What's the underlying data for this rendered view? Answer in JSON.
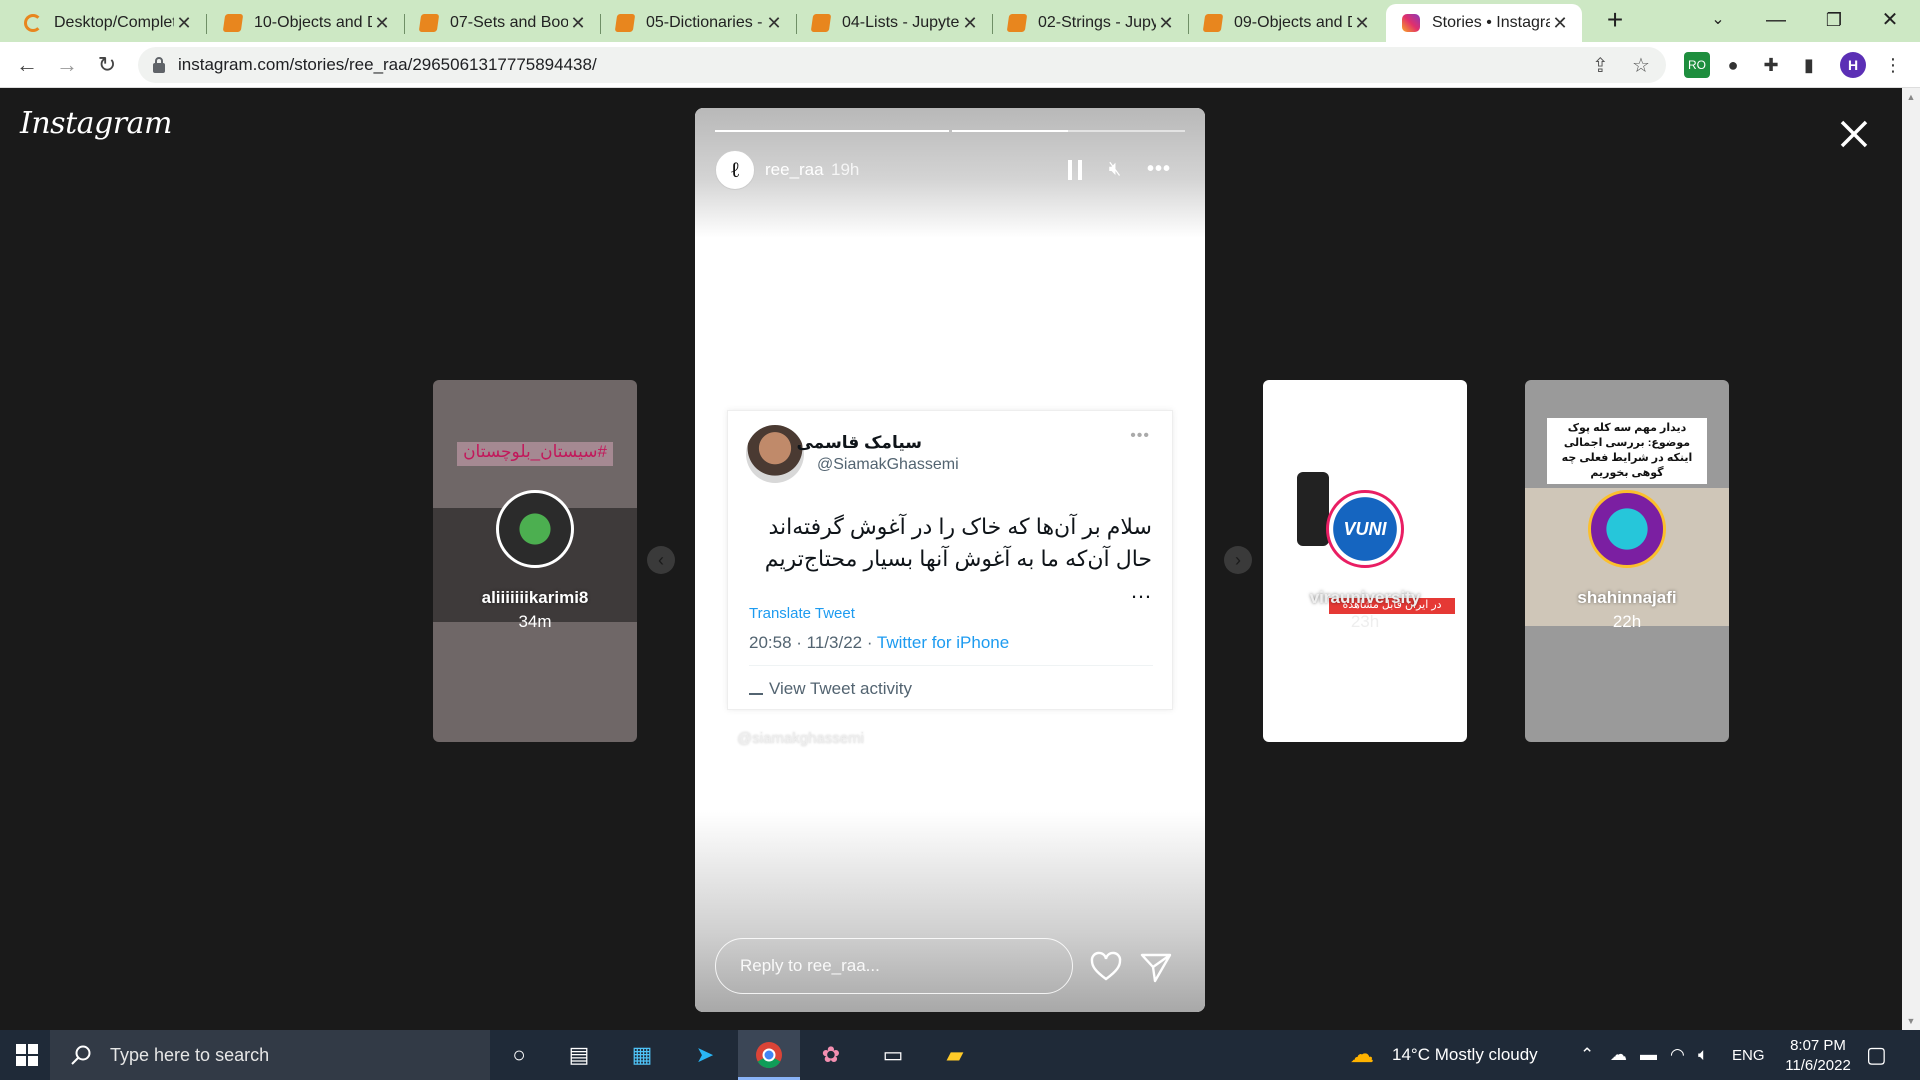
{
  "browser": {
    "tabs": [
      {
        "title": "Desktop/Complet",
        "icon": "loading-spinner-icon"
      },
      {
        "title": "10-Objects and D",
        "icon": "jupyter-notebook-icon"
      },
      {
        "title": "07-Sets and Bool",
        "icon": "jupyter-notebook-icon"
      },
      {
        "title": "05-Dictionaries -",
        "icon": "jupyter-notebook-icon"
      },
      {
        "title": "04-Lists - Jupyter",
        "icon": "jupyter-notebook-icon"
      },
      {
        "title": "02-Strings - Jupy",
        "icon": "jupyter-notebook-icon"
      },
      {
        "title": "09-Objects and D",
        "icon": "jupyter-notebook-icon"
      },
      {
        "title": "Stories • Instagra",
        "icon": "instagram-icon",
        "active": true
      }
    ],
    "url": "instagram.com/stories/ree_raa/2965061317775894438/",
    "profile_initial": "H",
    "accent": "#cde8c4"
  },
  "instagram": {
    "logo": "Instagram",
    "story": {
      "username": "ree_raa",
      "time_ago": "19h",
      "progress_segments": [
        1.0,
        0.5
      ],
      "reply_placeholder": "Reply to ree_raa...",
      "tweet": {
        "name": "سیامک قاسمی",
        "handle": "@SiamakGhassemi",
        "text_line1": "سلام بر آن‌ها که خاک را در آغوش گرفته‌اند",
        "text_line2": "حال آن‌که ما به آغوش آنها بسیار محتاج‌تریم …",
        "translate": "Translate Tweet",
        "timestamp": "20:58 · 11/3/22 ·",
        "source": "Twitter for iPhone",
        "activity": "View Tweet activity",
        "watermark": "@siamakghassemi"
      }
    },
    "side_stories": [
      {
        "username": "aliiiiiiikarimi8",
        "time_ago": "34m",
        "overlay_text": "#سیستان_بلوچستان"
      },
      {
        "username": "virauniversity",
        "time_ago": "23h",
        "overlay_text": "در ایران قابل مشاهده نیست"
      },
      {
        "username": "shahinnajafi",
        "time_ago": "22h",
        "overlay_text": "دیدار مهم سه کله پوک موضوع: بررسی اجمالی اینکه در شرایط فعلی چه گوهی بخوریم"
      }
    ]
  },
  "taskbar": {
    "search_placeholder": "Type here to search",
    "weather": "14°C  Mostly cloudy",
    "language": "ENG",
    "time": "8:07 PM",
    "date": "11/6/2022"
  }
}
